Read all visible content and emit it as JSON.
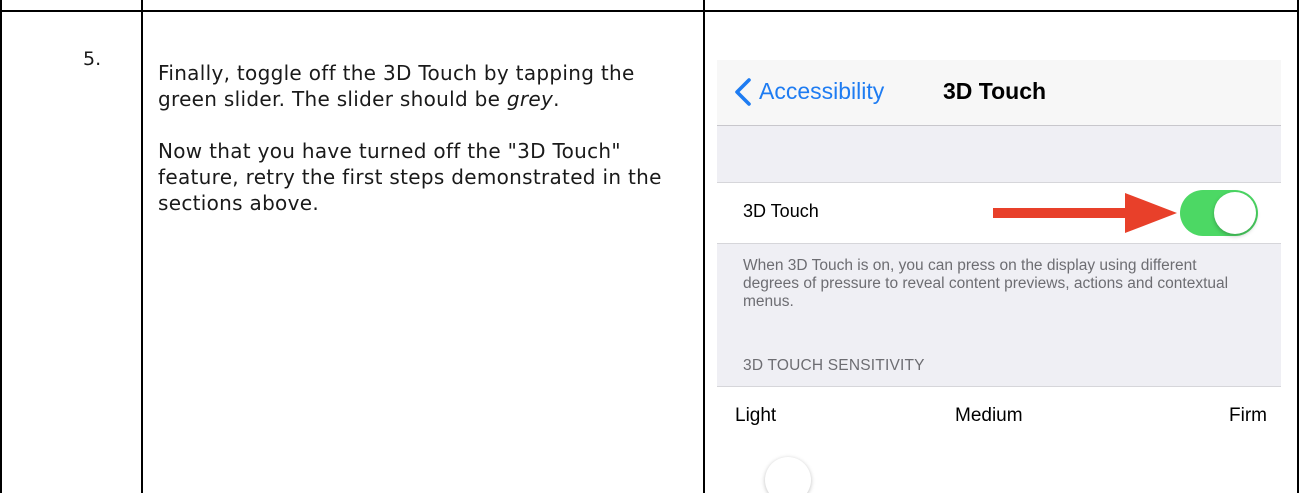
{
  "step": {
    "number": "5."
  },
  "instructions": {
    "p1_before": "Finally, toggle off the 3D Touch by tapping the green slider. The slider should be ",
    "p1_emphasis": "grey",
    "p1_after": ".",
    "p2": "Now that you have turned off the \"3D Touch\" feature, retry the first steps demonstrated in the sections above."
  },
  "screenshot": {
    "nav": {
      "back_label": "Accessibility",
      "title": "3D Touch"
    },
    "toggle_row": {
      "label": "3D Touch",
      "state": "on",
      "on_color": "#4cd864"
    },
    "annotation": {
      "arrow_color": "#e8402a",
      "icon": "arrow-right-icon"
    },
    "footer": "When 3D Touch is on, you can press on the display using different degrees of pressure to reveal content previews, actions and contextual menus.",
    "section_header": "3D TOUCH SENSITIVITY",
    "sensitivity": {
      "light": "Light",
      "medium": "Medium",
      "firm": "Firm"
    },
    "accent_color": "#1e7cf2"
  }
}
